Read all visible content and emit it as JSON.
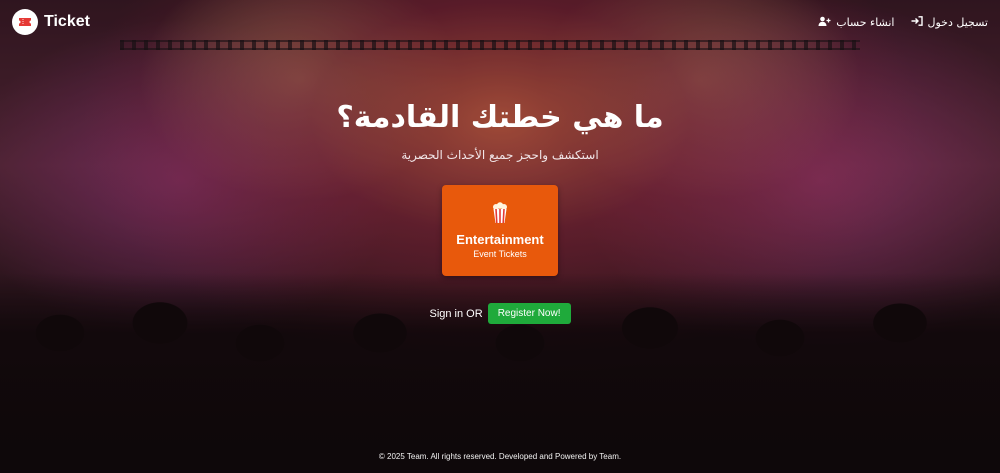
{
  "brand": {
    "name": "Ticket",
    "icon": "ticket-icon",
    "accent": "#e53935"
  },
  "nav": {
    "register_label": "انشاء حساب",
    "register_icon": "user-plus-icon",
    "login_label": "تسجيل دخول",
    "login_icon": "sign-in-icon"
  },
  "hero": {
    "title": "ما هي خطتك القادمة؟",
    "subtitle": "استكشف واحجز جميع الأحداث الحصرية"
  },
  "card": {
    "title": "Entertainment",
    "subtitle": "Event Tickets",
    "icon": "popcorn-icon",
    "color": "#e8590c"
  },
  "cta": {
    "signin_text": "Sign in OR",
    "register_button": "Register Now!",
    "button_color": "#1faa3b"
  },
  "footer": {
    "text": "© 2025 Team. All rights reserved. Developed and Powered by Team."
  }
}
